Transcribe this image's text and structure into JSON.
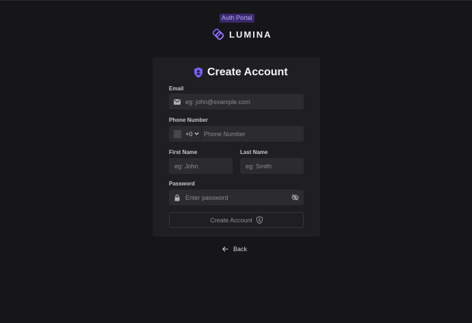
{
  "header": {
    "badge": "Auth Portal",
    "brand": "LUMINA"
  },
  "form": {
    "title": "Create Account",
    "email": {
      "label": "Email",
      "placeholder": "eg: john@example.com"
    },
    "phone": {
      "label": "Phone Number",
      "dial_code": "+0",
      "placeholder": "Phone Number"
    },
    "first_name": {
      "label": "First Name",
      "placeholder": "eg: John"
    },
    "last_name": {
      "label": "Last Name",
      "placeholder": "eg: Smith"
    },
    "password": {
      "label": "Password",
      "placeholder": "Enter password"
    },
    "submit_label": "Create Account"
  },
  "nav": {
    "back_label": "Back"
  },
  "colors": {
    "accent": "#7c5cff",
    "background": "#161618",
    "card": "#1f1f22",
    "field": "#2c2c30"
  },
  "icons": [
    "lumina-logo-icon",
    "shield-icon",
    "mail-icon",
    "chevron-down-icon",
    "lock-icon",
    "eye-off-icon",
    "user-shield-icon",
    "arrow-left-icon"
  ]
}
